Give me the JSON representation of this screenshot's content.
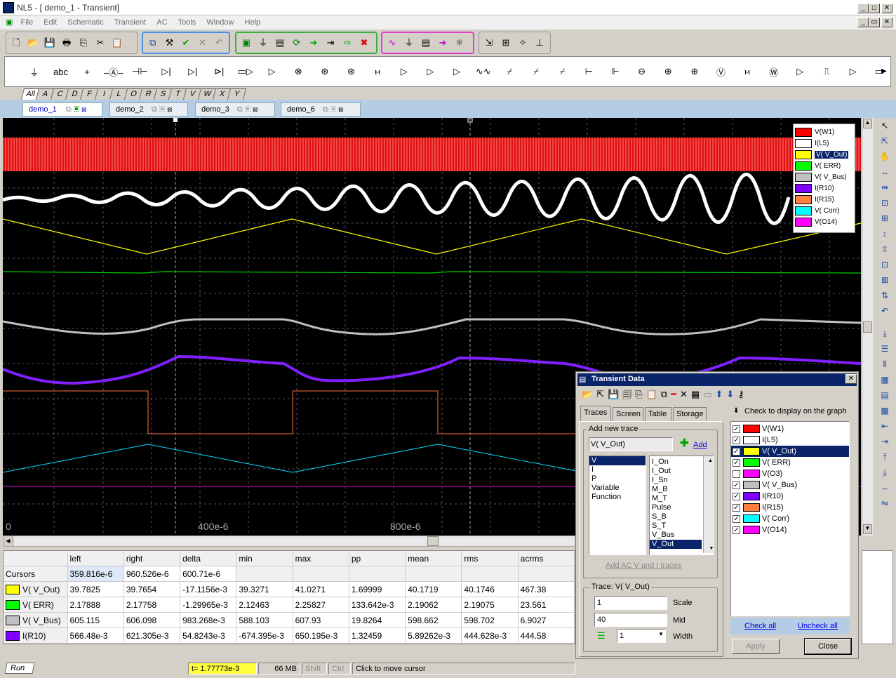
{
  "window": {
    "title": "NL5 - [ demo_1 - Transient]"
  },
  "menu": [
    "File",
    "Edit",
    "Schematic",
    "Transient",
    "AC",
    "Tools",
    "Window",
    "Help"
  ],
  "letter_tabs": [
    "All",
    "A",
    "C",
    "D",
    "F",
    "I",
    "L",
    "O",
    "R",
    "S",
    "T",
    "V",
    "W",
    "X",
    "Y"
  ],
  "doc_tabs": [
    {
      "label": "demo_1",
      "active": true
    },
    {
      "label": "demo_2",
      "active": false
    },
    {
      "label": "demo_3",
      "active": false
    },
    {
      "label": "demo_6",
      "active": false
    }
  ],
  "graph": {
    "x_labels": [
      "0",
      "400e-6",
      "800e-6"
    ],
    "legend": [
      {
        "label": "V(W1)",
        "color": "#ff0000"
      },
      {
        "label": "I(L5)",
        "color": "#ffffff"
      },
      {
        "label": "V( V_Out)",
        "color": "#ffff00",
        "selected": true
      },
      {
        "label": "V( ERR)",
        "color": "#00ff00"
      },
      {
        "label": "V( V_Bus)",
        "color": "#c0c0c0"
      },
      {
        "label": "I(R10)",
        "color": "#8000ff"
      },
      {
        "label": "I(R15)",
        "color": "#ff8040"
      },
      {
        "label": "V( Corr)",
        "color": "#00ffff"
      },
      {
        "label": "V(O14)",
        "color": "#ff00ff"
      }
    ]
  },
  "table": {
    "headers": [
      "",
      "left",
      "right",
      "delta",
      "min",
      "max",
      "pp",
      "mean",
      "rms",
      "acrms"
    ],
    "rows": [
      {
        "name": "Cursors",
        "color": "",
        "cells": [
          "359.816e-6",
          "960.526e-6",
          "600.71e-6",
          "",
          "",
          "",
          "",
          "",
          ""
        ]
      },
      {
        "name": "V( V_Out)",
        "color": "#ffff00",
        "cells": [
          "39.7825",
          "39.7654",
          "-17.1156e-3",
          "39.3271",
          "41.0271",
          "1.69999",
          "40.1719",
          "40.1746",
          "467.38"
        ]
      },
      {
        "name": "V( ERR)",
        "color": "#00ff00",
        "cells": [
          "2.17888",
          "2.17758",
          "-1.29965e-3",
          "2.12463",
          "2.25827",
          "133.642e-3",
          "2.19062",
          "2.19075",
          "23.561"
        ]
      },
      {
        "name": "V( V_Bus)",
        "color": "#c0c0c0",
        "cells": [
          "605.115",
          "606.098",
          "983.268e-3",
          "588.103",
          "607.93",
          "19.8264",
          "598.662",
          "598.702",
          "6.9027"
        ]
      },
      {
        "name": "I(R10)",
        "color": "#8000ff",
        "cells": [
          "566.48e-3",
          "621.305e-3",
          "54.8243e-3",
          "-674.395e-3",
          "650.195e-3",
          "1.32459",
          "5.89262e-3",
          "444.628e-3",
          "444.58"
        ]
      }
    ]
  },
  "status": {
    "tab": "Run",
    "time": "t= 1.77773e-3",
    "memory": "66 MB",
    "shift": "Shift",
    "ctrl": "Ctrl",
    "hint": "Click to move cursor"
  },
  "dialog": {
    "title": "Transient Data",
    "tabs": [
      "Traces",
      "Screen",
      "Table",
      "Storage"
    ],
    "add_new_trace": "Add new trace",
    "trace_input": "V( V_Out)",
    "add_label": "Add",
    "types": [
      "V",
      "I",
      "P",
      "Variable",
      "Function"
    ],
    "names": [
      "I_On",
      "I_Out",
      "I_Sn",
      "M_B",
      "M_T",
      "Pulse",
      "S_B",
      "S_T",
      "V_Bus",
      "V_Out"
    ],
    "add_ac_link": "Add AC V and I traces",
    "trace_group": "Trace: V( V_Out)",
    "scale_value": "1",
    "scale_label": "Scale",
    "mid_value": "40",
    "mid_label": "Mid",
    "width_value": "1",
    "width_label": "Width",
    "check_header": "Check to display on the graph",
    "traces": [
      {
        "label": "V(W1)",
        "color": "#ff0000",
        "checked": true
      },
      {
        "label": "I(L5)",
        "color": "#ffffff",
        "checked": true
      },
      {
        "label": "V( V_Out)",
        "color": "#ffff00",
        "checked": true,
        "selected": true
      },
      {
        "label": "V( ERR)",
        "color": "#00ff00",
        "checked": true
      },
      {
        "label": "V(O3)",
        "color": "#ff00ff",
        "checked": false
      },
      {
        "label": "V( V_Bus)",
        "color": "#c0c0c0",
        "checked": true
      },
      {
        "label": "I(R10)",
        "color": "#8000ff",
        "checked": true
      },
      {
        "label": "I(R15)",
        "color": "#ff8040",
        "checked": true
      },
      {
        "label": "V( Corr)",
        "color": "#00ffff",
        "checked": true
      },
      {
        "label": "V(O14)",
        "color": "#ff00ff",
        "checked": true
      }
    ],
    "check_all": "Check all",
    "uncheck_all": "Uncheck all",
    "apply": "Apply",
    "close": "Close"
  }
}
